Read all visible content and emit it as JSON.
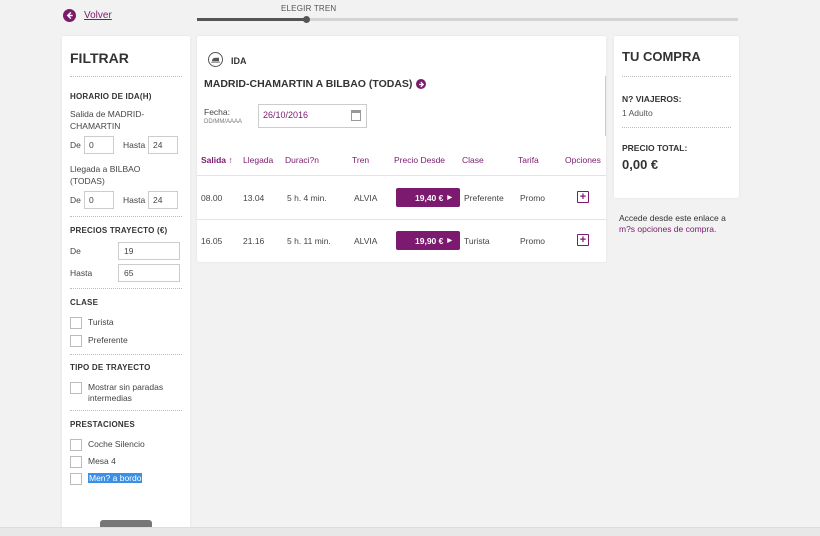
{
  "nav": {
    "back_label": "Volver",
    "step_label": "ELEGIR TREN"
  },
  "filter": {
    "title": "FILTRAR",
    "schedule": {
      "title": "HORARIO DE IDA(H)",
      "departure_label": "Salida de MADRID-CHAMARTIN",
      "arrival_label": "Llegada a BILBAO (TODAS)",
      "from_label": "De",
      "to_label": "Hasta",
      "departure_from": "0",
      "departure_to": "24",
      "arrival_from": "0",
      "arrival_to": "24"
    },
    "prices": {
      "title": "PRECIOS TRAYECTO (€)",
      "from_label": "De",
      "to_label": "Hasta",
      "from_value": "19",
      "to_value": "65"
    },
    "class": {
      "title": "CLASE",
      "options": [
        "Turista",
        "Preferente"
      ]
    },
    "trip_type": {
      "title": "TIPO DE TRAYECTO",
      "option": "Mostrar sin paradas intermedias"
    },
    "services": {
      "title": "PRESTACIONES",
      "options": [
        "Coche Silencio",
        "Mesa 4",
        "Men? a bordo"
      ]
    }
  },
  "results": {
    "direction": "IDA",
    "route": "MADRID-CHAMARTIN A BILBAO (TODAS)",
    "date_label": "Fecha:",
    "date_format": "DD/MM/AAAA",
    "date_value": "26/10/2016",
    "columns": [
      "Salida ↑",
      "Llegada",
      "Duraci?n",
      "Tren",
      "Precio Desde",
      "Clase",
      "Tarifa",
      "Opciones"
    ],
    "rows": [
      {
        "departure": "08.00",
        "arrival": "13.04",
        "duration": "5 h. 4 min.",
        "train": "ALVIA",
        "price": "19,40 €",
        "class": "Preferente",
        "fare": "Promo"
      },
      {
        "departure": "16.05",
        "arrival": "21.16",
        "duration": "5 h. 11 min.",
        "train": "ALVIA",
        "price": "19,90 €",
        "class": "Turista",
        "fare": "Promo"
      }
    ]
  },
  "purchase": {
    "title": "TU COMPRA",
    "travelers_label": "N? VIAJEROS:",
    "travelers_value": "1 Adulto",
    "total_label": "PRECIO TOTAL:",
    "total_value": "0,00 €",
    "note_text": "Accede desde este enlace a",
    "note_link": "m?s opciones de compra."
  },
  "colors": {
    "accent": "#7b1a6e",
    "highlight": "#3b8fe5"
  }
}
